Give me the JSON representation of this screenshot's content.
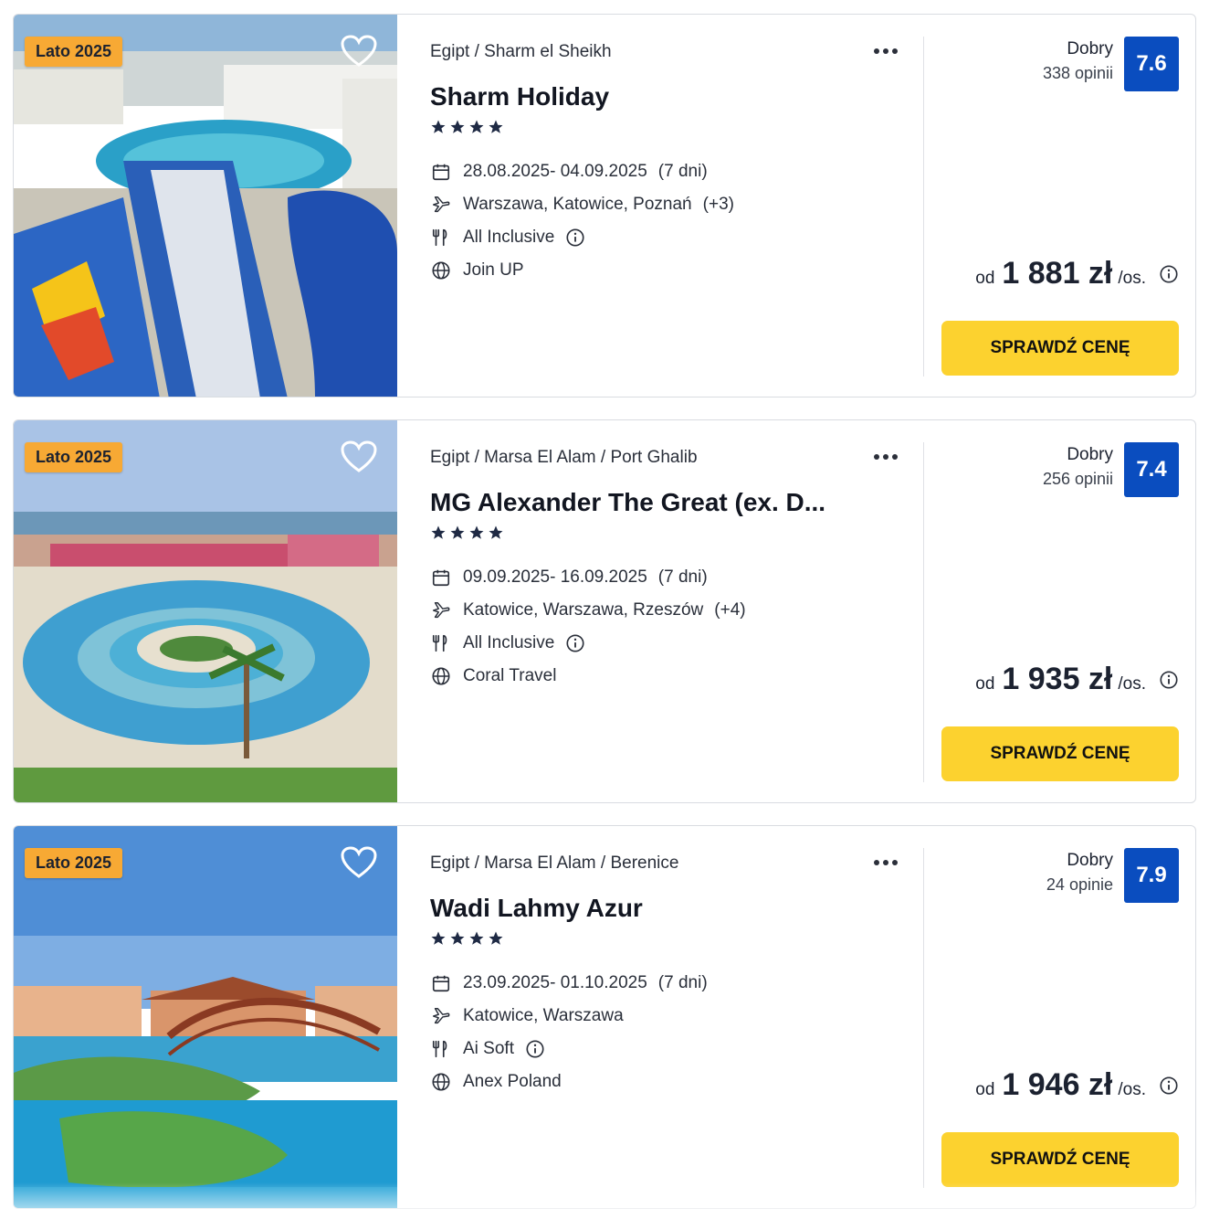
{
  "offers": [
    {
      "badge": "Lato 2025",
      "location": "Egipt / Sharm el Sheikh",
      "name": "Sharm Holiday",
      "stars": 4,
      "dates": "28.08.2025- 04.09.2025",
      "duration": "(7 dni)",
      "departures": "Warszawa, Katowice, Poznań",
      "departures_extra": "(+3)",
      "board": "All Inclusive",
      "operator": "Join UP",
      "rating_word": "Dobry",
      "reviews": "338 opinii",
      "score": "7.6",
      "price_prefix": "od",
      "price": "1 881 zł",
      "price_unit": "/os.",
      "cta": "SPRAWDŹ CENĘ"
    },
    {
      "badge": "Lato 2025",
      "location": "Egipt / Marsa El Alam / Port Ghalib",
      "name": "MG Alexander The Great (ex. D...",
      "stars": 4,
      "dates": "09.09.2025- 16.09.2025",
      "duration": "(7 dni)",
      "departures": "Katowice, Warszawa, Rzeszów",
      "departures_extra": "(+4)",
      "board": "All Inclusive",
      "operator": "Coral Travel",
      "rating_word": "Dobry",
      "reviews": "256 opinii",
      "score": "7.4",
      "price_prefix": "od",
      "price": "1 935 zł",
      "price_unit": "/os.",
      "cta": "SPRAWDŹ CENĘ"
    },
    {
      "badge": "Lato 2025",
      "location": "Egipt / Marsa El Alam / Berenice",
      "name": "Wadi Lahmy Azur",
      "stars": 4,
      "dates": "23.09.2025- 01.10.2025",
      "duration": "(7 dni)",
      "departures": "Katowice, Warszawa",
      "departures_extra": "",
      "board": "Ai Soft",
      "operator": "Anex Poland",
      "rating_word": "Dobry",
      "reviews": "24 opinie",
      "score": "7.9",
      "price_prefix": "od",
      "price": "1 946 zł",
      "price_unit": "/os.",
      "cta": "SPRAWDŹ CENĘ"
    }
  ],
  "colors": {
    "badge": "#f7a934",
    "score": "#0a4dbf",
    "cta": "#fcd22f"
  },
  "icons": [
    "heart-icon",
    "more-icon",
    "calendar-icon",
    "plane-icon",
    "cutlery-icon",
    "info-icon",
    "globe-icon",
    "star-icon"
  ]
}
